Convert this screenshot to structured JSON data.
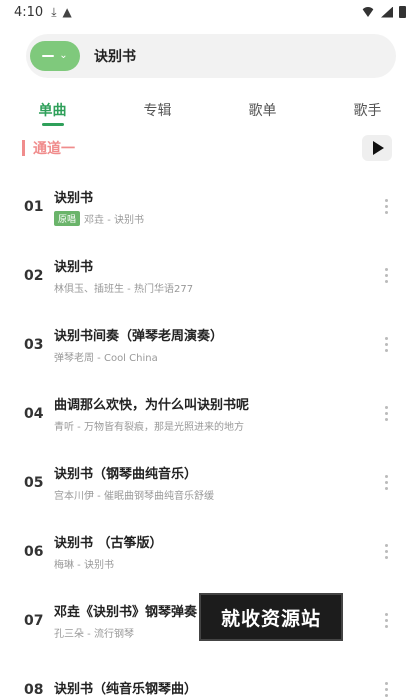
{
  "status": {
    "time": "4:10"
  },
  "search": {
    "value": "诀别书"
  },
  "tabs": [
    {
      "label": "单曲"
    },
    {
      "label": "专辑"
    },
    {
      "label": "歌单"
    },
    {
      "label": "歌手"
    }
  ],
  "channel": {
    "label": "通道一"
  },
  "songs": [
    {
      "num": "01",
      "title": "诀别书",
      "tag": "原唱",
      "sub": "邓垚 - 诀别书"
    },
    {
      "num": "02",
      "title": "诀别书",
      "sub": "林俱玉、插班生 - 热门华语277"
    },
    {
      "num": "03",
      "title": "诀别书间奏（弹琴老周演奏）",
      "sub": "弹琴老周 - Cool China"
    },
    {
      "num": "04",
      "title": "曲调那么欢快，为什么叫诀别书呢",
      "sub": "青听 - 万物皆有裂痕，那是光照进来的地方"
    },
    {
      "num": "05",
      "title": "诀别书（钢琴曲纯音乐）",
      "sub": "宫本川伊 - 催眠曲钢琴曲纯音乐舒缓"
    },
    {
      "num": "06",
      "title": "诀别书 （古筝版）",
      "sub": "梅琳 - 诀别书"
    },
    {
      "num": "07",
      "title": "邓垚《诀别书》钢琴弹奏",
      "sub": "孔三朵 - 流行钢琴"
    },
    {
      "num": "08",
      "title": "诀别书（纯音乐钢琴曲）",
      "sub": ""
    }
  ],
  "watermark": {
    "text": "就收资源站"
  },
  "colors": {
    "accent": "#2fa05a",
    "channel": "#f08c8c",
    "pill": "#7fc97c",
    "tag": "#6ab46a"
  }
}
